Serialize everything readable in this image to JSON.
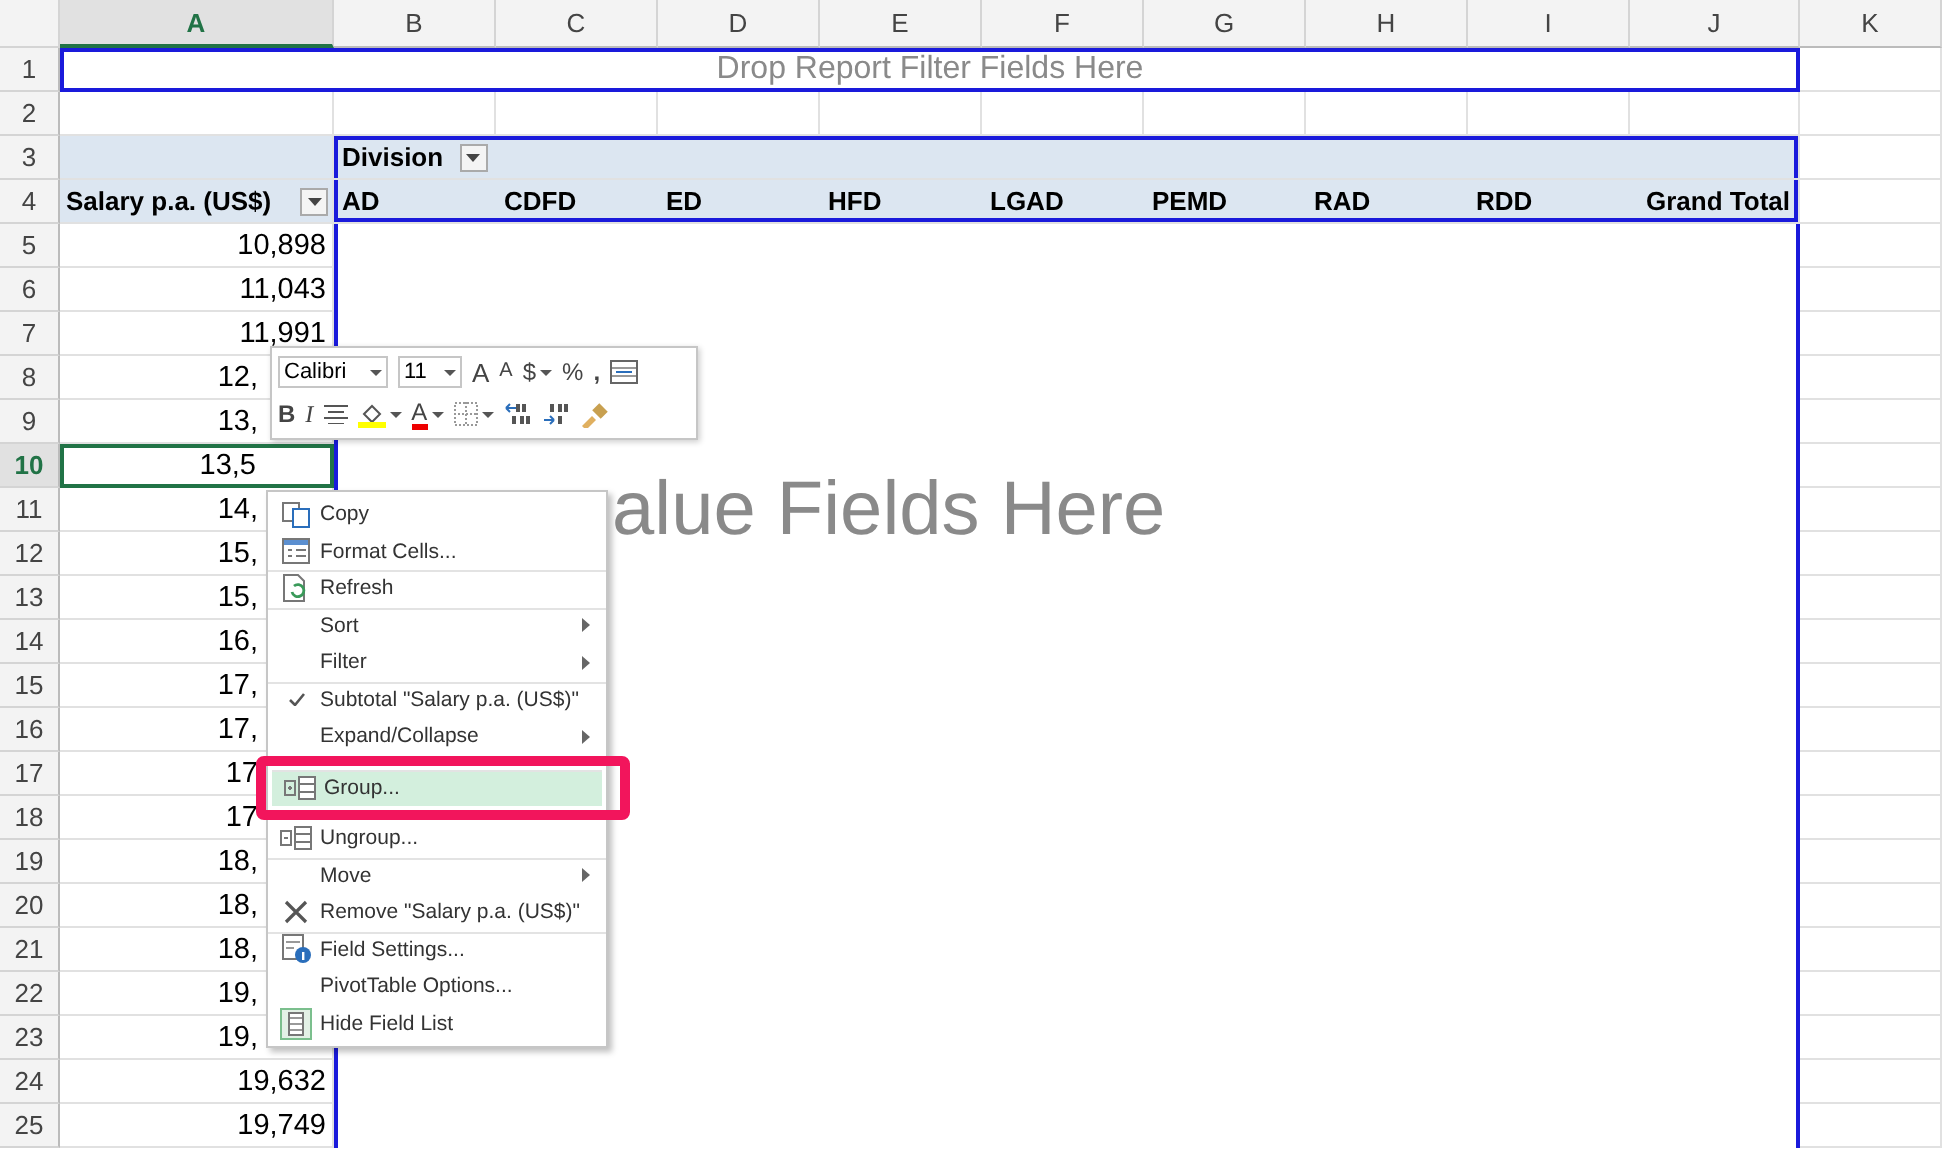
{
  "columns": [
    {
      "label": "A",
      "selected": true
    },
    {
      "label": "B",
      "selected": false
    },
    {
      "label": "C",
      "selected": false
    },
    {
      "label": "D",
      "selected": false
    },
    {
      "label": "E",
      "selected": false
    },
    {
      "label": "F",
      "selected": false
    },
    {
      "label": "G",
      "selected": false
    },
    {
      "label": "H",
      "selected": false
    },
    {
      "label": "I",
      "selected": false
    },
    {
      "label": "J",
      "selected": false
    },
    {
      "label": "K",
      "selected": false
    }
  ],
  "rows": [
    {
      "number": "1",
      "kind": "filter",
      "selected": false,
      "text": "Drop Report Filter Fields Here"
    },
    {
      "number": "2",
      "kind": "blank",
      "selected": false
    },
    {
      "number": "3",
      "kind": "pivot_head",
      "selected": false,
      "text": "Division"
    },
    {
      "number": "4",
      "kind": "pivot_items",
      "selected": false,
      "text": "Salary p.a. (US$)",
      "items": [
        "AD",
        "CDFD",
        "ED",
        "HFD",
        "LGAD",
        "PEMD",
        "RAD",
        "RDD",
        "Grand Total"
      ]
    },
    {
      "number": "5",
      "kind": "value",
      "selected": false,
      "text": "10,898"
    },
    {
      "number": "6",
      "kind": "value",
      "selected": false,
      "text": "11,043"
    },
    {
      "number": "7",
      "kind": "value",
      "selected": false,
      "text": "11,991"
    },
    {
      "number": "8",
      "kind": "partial",
      "selected": false,
      "text": "12,"
    },
    {
      "number": "9",
      "kind": "partial",
      "selected": false,
      "text": "13,"
    },
    {
      "number": "10",
      "kind": "partial",
      "selected": true,
      "text": "13,5"
    },
    {
      "number": "11",
      "kind": "partial",
      "selected": false,
      "text": "14,"
    },
    {
      "number": "12",
      "kind": "partial",
      "selected": false,
      "text": "15,"
    },
    {
      "number": "13",
      "kind": "partial",
      "selected": false,
      "text": "15,"
    },
    {
      "number": "14",
      "kind": "partial",
      "selected": false,
      "text": "16,"
    },
    {
      "number": "15",
      "kind": "partial",
      "selected": false,
      "text": "17,"
    },
    {
      "number": "16",
      "kind": "partial",
      "selected": false,
      "text": "17,"
    },
    {
      "number": "17",
      "kind": "partial",
      "selected": false,
      "text": "17"
    },
    {
      "number": "18",
      "kind": "partial",
      "selected": false,
      "text": "17"
    },
    {
      "number": "19",
      "kind": "partial",
      "selected": false,
      "text": "18,"
    },
    {
      "number": "20",
      "kind": "partial",
      "selected": false,
      "text": "18,"
    },
    {
      "number": "21",
      "kind": "partial",
      "selected": false,
      "text": "18,"
    },
    {
      "number": "22",
      "kind": "partial",
      "selected": false,
      "text": "19,"
    },
    {
      "number": "23",
      "kind": "partial",
      "selected": false,
      "text": "19,"
    },
    {
      "number": "24",
      "kind": "value",
      "selected": false,
      "text": "19,632"
    },
    {
      "number": "25",
      "kind": "value",
      "selected": false,
      "text": "19,749"
    }
  ],
  "values_placeholder": "alue Fields Here",
  "mini_toolbar": {
    "font": "Calibri",
    "size": "11",
    "grow": "A",
    "shrink": "A",
    "currency": "$",
    "percent": "%",
    "comma": ",",
    "bold": "B",
    "italic": "I",
    "font_color": "A"
  },
  "context_menu": [
    {
      "label": "Copy",
      "submenu": false,
      "checked": false,
      "selected": false,
      "separator_before": false
    },
    {
      "label": "Format Cells...",
      "submenu": false,
      "checked": false,
      "selected": false,
      "separator_before": false
    },
    {
      "label": "Refresh",
      "submenu": false,
      "checked": false,
      "selected": false,
      "separator_before": true
    },
    {
      "label": "Sort",
      "submenu": true,
      "checked": false,
      "selected": false,
      "separator_before": true
    },
    {
      "label": "Filter",
      "submenu": true,
      "checked": false,
      "selected": false,
      "separator_before": false
    },
    {
      "label": "Subtotal \"Salary p.a. (US$)\"",
      "submenu": false,
      "checked": true,
      "selected": false,
      "separator_before": true
    },
    {
      "label": "Expand/Collapse",
      "submenu": true,
      "checked": false,
      "selected": false,
      "separator_before": false
    },
    {
      "label": "Group...",
      "submenu": false,
      "checked": false,
      "selected": true,
      "separator_before": true
    },
    {
      "label": "Ungroup...",
      "submenu": false,
      "checked": false,
      "selected": false,
      "separator_before": false
    },
    {
      "label": "Move",
      "submenu": true,
      "checked": false,
      "selected": false,
      "separator_before": true
    },
    {
      "label": "Remove \"Salary p.a. (US$)\"",
      "submenu": false,
      "checked": false,
      "selected": false,
      "separator_before": false
    },
    {
      "label": "Field Settings...",
      "submenu": false,
      "checked": false,
      "selected": false,
      "separator_before": true
    },
    {
      "label": "PivotTable Options...",
      "submenu": false,
      "checked": false,
      "selected": false,
      "separator_before": false
    },
    {
      "label": "Hide Field List",
      "submenu": false,
      "checked": false,
      "selected": false,
      "separator_before": false
    }
  ]
}
